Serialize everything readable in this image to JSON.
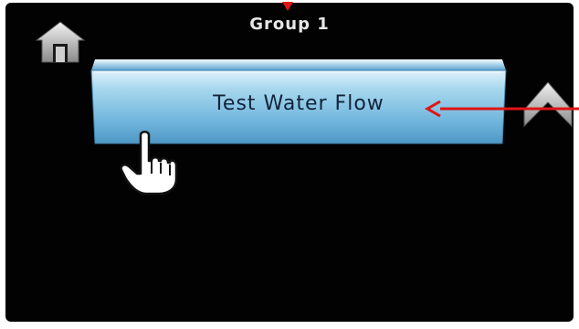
{
  "header": {
    "title": "Group 1"
  },
  "main": {
    "button_label": "Test Water Flow"
  },
  "icons": {
    "home": "home-icon",
    "up": "up-arrow-icon",
    "pointer": "pointing-hand-icon",
    "annotation_right": "red-arrow-icon",
    "annotation_top": "red-arrow-icon"
  },
  "colors": {
    "screen_bg": "#020202",
    "button_blue": "#8ec7e6",
    "annotation_red": "#e01414"
  }
}
